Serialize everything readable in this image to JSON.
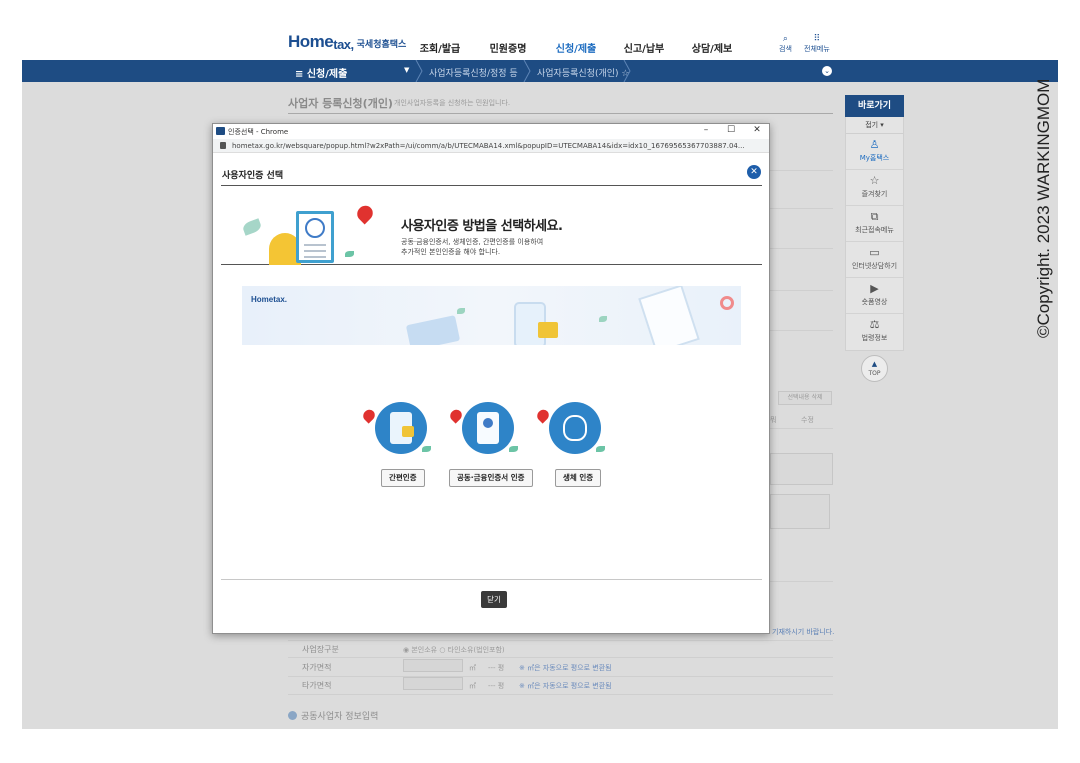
{
  "header": {
    "logo_main": "Home",
    "logo_sub": "tax,",
    "logo_name": "국세청홈택스",
    "nav": [
      "조회/발급",
      "민원증명",
      "신청/제출",
      "신고/납부",
      "상담/제보"
    ],
    "active_nav": "신청/제출",
    "search_label": "검색",
    "all_menu_label": "전체메뉴"
  },
  "navbar": {
    "menu_label": "≡ 신청/제출",
    "crumb1": "사업자등록신청/정정 등",
    "crumb2": "사업자등록신청(개인) ☆"
  },
  "page": {
    "title": "사업자 등록신청(개인)",
    "desc": "개인사업자등록을 신청하는 민원입니다.",
    "rows": [
      {
        "label": "사업장구분",
        "note": "◉ 본인소유   ○ 타인소유(법인포함)"
      },
      {
        "label": "자가면적",
        "unit": "㎡",
        "pyeong": "--- 평",
        "note": "※ ㎡은 자동으로 평으로 변환됨"
      },
      {
        "label": "타가면적",
        "unit": "㎡",
        "pyeong": "--- 평",
        "note": "※ ㎡은 자동으로 평으로 변환됨"
      }
    ],
    "section": "공동사업자 정보입력",
    "bg_delete": "선택내용 삭제",
    "bg_edit": "수정",
    "bg_fragment": "기재하시기 바랍니다."
  },
  "quick": {
    "title": "바로가기",
    "fold": "접기 ▾",
    "items": [
      {
        "label": "My홈택스",
        "icon": "person-icon",
        "glyph": "♙"
      },
      {
        "label": "즐겨찾기",
        "icon": "star-icon",
        "glyph": "☆"
      },
      {
        "label": "최근접속메뉴",
        "icon": "recent-menu-icon",
        "glyph": "⧉"
      },
      {
        "label": "인터넷상담하기",
        "icon": "chat-icon",
        "glyph": "▭"
      },
      {
        "label": "숏폼영상",
        "icon": "play-icon",
        "glyph": "▶"
      },
      {
        "label": "법령정보",
        "icon": "gavel-icon",
        "glyph": "⚖"
      }
    ],
    "top": "TOP"
  },
  "copyright": "©Copyright. 2023 WARKINGMOM",
  "popup": {
    "window_title": "인증선택 - Chrome",
    "url": "hometax.go.kr/websquare/popup.html?w2xPath=/ui/comm/a/b/UTECMABA14.xml&popupID=UTECMABA14&idx=idx10_16769565367703887.04...",
    "heading": "사용자인증 선택",
    "intro_title": "사용자인증 방법을 선택하세요.",
    "intro_desc_1": "공동·금융인증서, 생체인증, 간편인증를 이용하여",
    "intro_desc_2": "추가적인 본인인증을 해야 합니다.",
    "banner_logo": "Hometax.",
    "options": [
      "간편인증",
      "공동·금융인증서 인증",
      "생체 인증"
    ],
    "close_label": "닫기",
    "win_min": "–",
    "win_max": "☐",
    "win_close": "✕",
    "close_x": "✕"
  },
  "colors": {
    "brand_navy": "#1e4c83",
    "accent_blue": "#1d6cc0",
    "auth_circle": "#2e84c8",
    "heart_red": "#e0322f"
  }
}
